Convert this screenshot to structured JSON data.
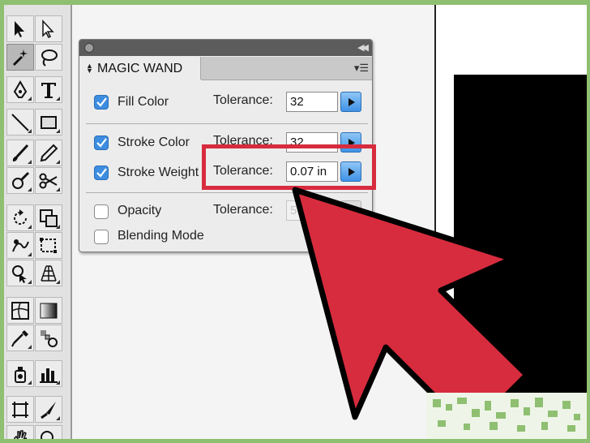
{
  "panel": {
    "title": "MAGIC WAND",
    "rows": [
      {
        "label": "Fill Color",
        "checked": true,
        "tolerance_label": "Tolerance:",
        "value": "32",
        "enabled": true
      },
      {
        "label": "Stroke Color",
        "checked": true,
        "tolerance_label": "Tolerance:",
        "value": "32",
        "enabled": true
      },
      {
        "label": "Stroke Weight",
        "checked": true,
        "tolerance_label": "Tolerance:",
        "value": "0.07 in",
        "enabled": true
      },
      {
        "label": "Opacity",
        "checked": false,
        "tolerance_label": "Tolerance:",
        "value": "5",
        "enabled": false
      },
      {
        "label": "Blending Mode",
        "checked": false
      }
    ]
  },
  "colors": {
    "highlight": "#d72c3e",
    "arrow": "#d72c3e",
    "checkbox": "#3d8de0",
    "background_border": "#8fbf71"
  },
  "toolbar": {
    "tools": [
      "selection-tool",
      "direct-selection-tool",
      "magic-wand-tool",
      "lasso-tool",
      "pen-tool",
      "type-tool",
      "line-segment-tool",
      "rectangle-tool",
      "paintbrush-tool",
      "pencil-tool",
      "blob-brush-tool",
      "scissors-tool",
      "rotate-tool",
      "scale-tool",
      "warp-tool",
      "free-transform-tool",
      "shape-builder-tool",
      "perspective-grid-tool",
      "mesh-tool",
      "gradient-tool",
      "eyedropper-tool",
      "blend-tool",
      "symbol-sprayer-tool",
      "column-graph-tool",
      "artboard-tool",
      "slice-tool",
      "hand-tool",
      "zoom-tool"
    ]
  }
}
